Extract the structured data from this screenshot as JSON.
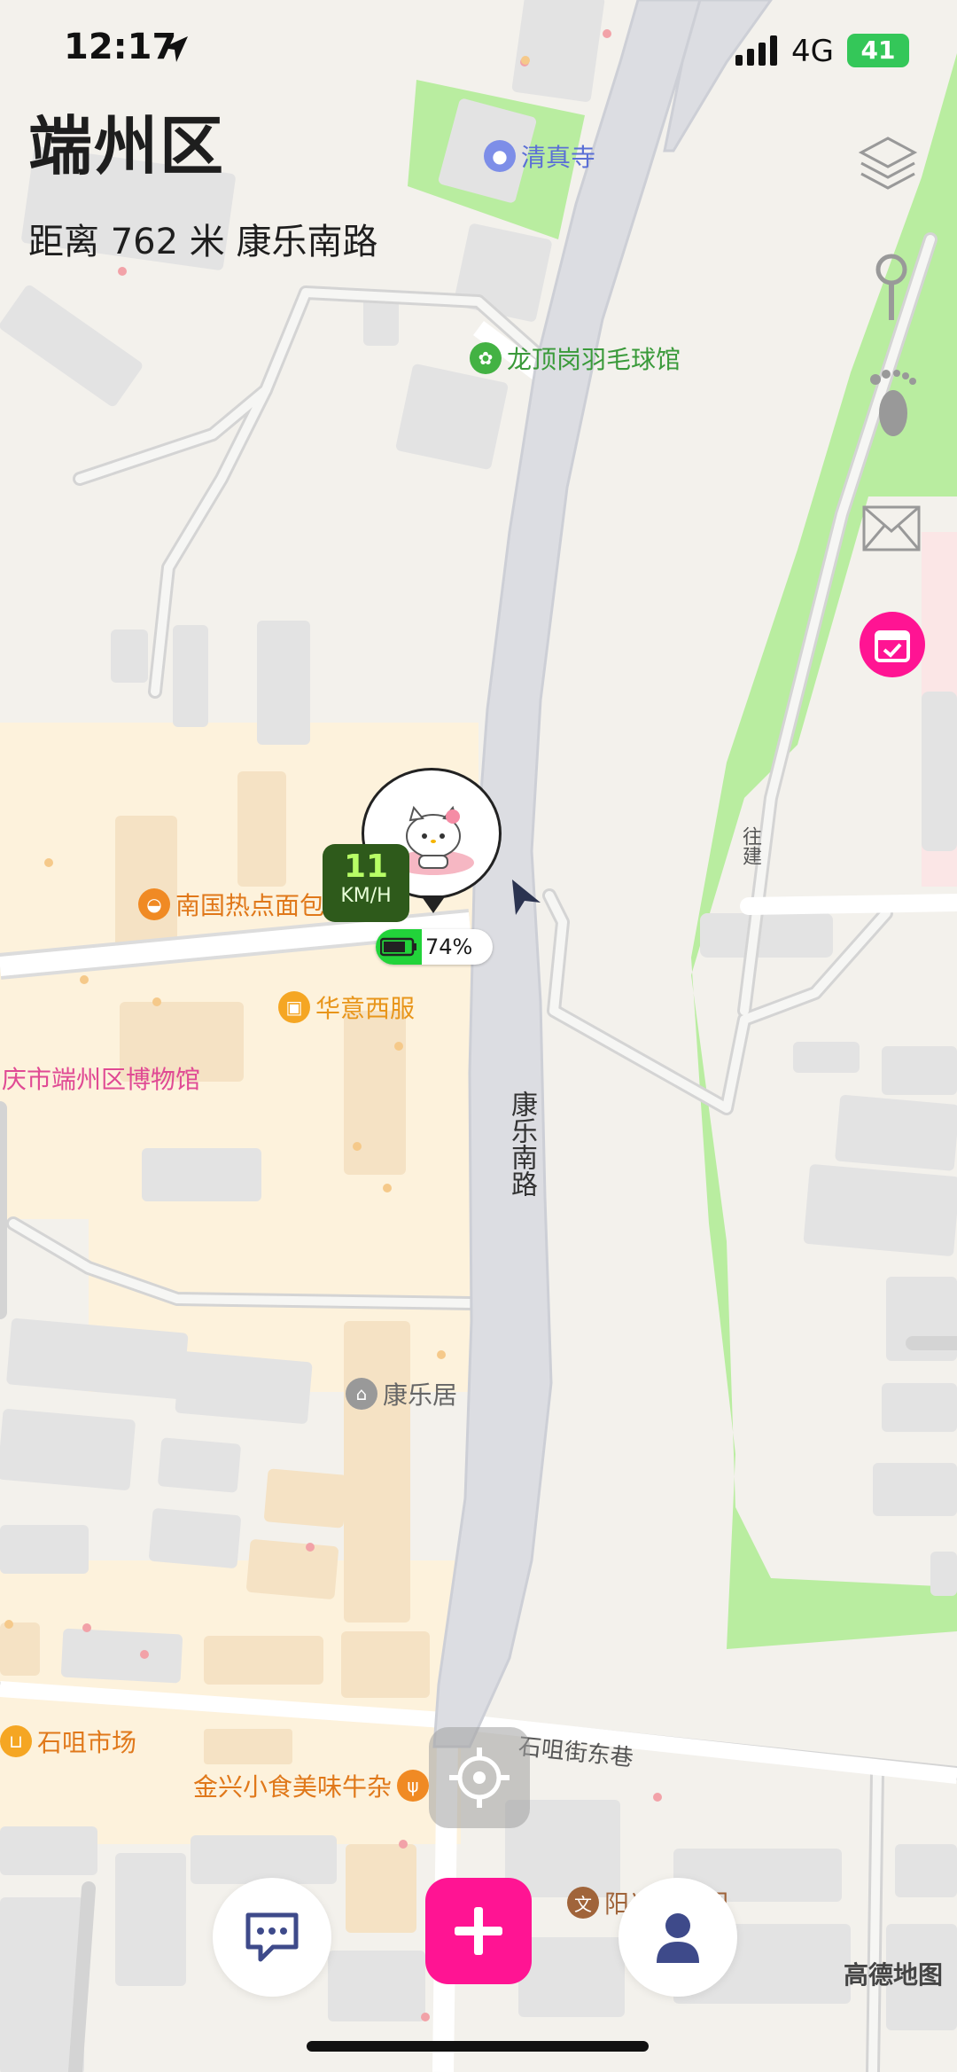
{
  "status_bar": {
    "time": "12:17",
    "network": "4G",
    "battery": "41"
  },
  "header": {
    "district": "端州区",
    "distance_line": "距离 762 米 康乐南路"
  },
  "pois": {
    "qingzhen": "清真寺",
    "badminton": "龙顶岗羽毛球馆",
    "nanguo": "南国热点面包",
    "huayi": "华意西服",
    "museum": "庆市端州区博物馆",
    "kangleju": "康乐居",
    "shijie_market": "石咀市场",
    "jinxing": "金兴小食美味牛杂",
    "yangguang": "阳光幼儿园"
  },
  "roads": {
    "kangle_south": "康乐南路",
    "shijie_east_lane": "石咀街东巷",
    "wangjian": "往建"
  },
  "tracker": {
    "speed": "11",
    "speed_unit": "KM/H",
    "battery": "74%"
  },
  "map": {
    "provider_logo": "高德地图"
  },
  "colors": {
    "accent_pink": "#ff1493",
    "speed_bg": "#2e5a1b",
    "battery_green": "#22d33a",
    "road_gray": "#dcdde2",
    "park_green": "#b9eda0"
  },
  "icons": {
    "layers": "layers-icon",
    "pin": "pin-icon",
    "footprint": "footprint-icon",
    "mail": "mail-icon",
    "calendar": "calendar-check-icon",
    "locate": "crosshair-icon",
    "chat": "chat-icon",
    "plus": "plus-icon",
    "profile": "person-icon"
  }
}
